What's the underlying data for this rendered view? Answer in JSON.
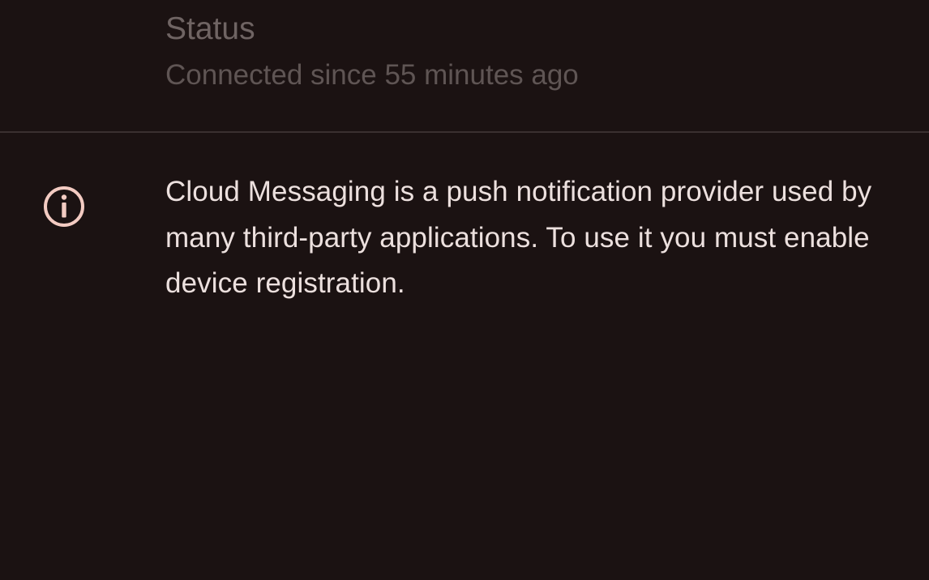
{
  "status": {
    "title": "Status",
    "summary": "Connected since 55 minutes ago"
  },
  "info": {
    "icon": "info-icon",
    "message": "Cloud Messaging is a push notification provider used by many third-party applications. To use it you must enable device registration."
  },
  "colors": {
    "background": "#1b1212",
    "primary_text": "#ece0de",
    "disabled_text": "#6f6463",
    "icon_accent": "#f3cbc2",
    "divider": "#3a3030"
  }
}
